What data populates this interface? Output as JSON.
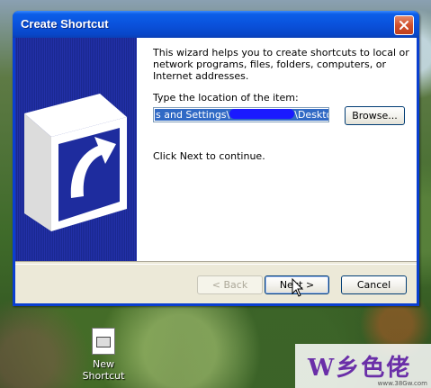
{
  "window": {
    "title": "Create Shortcut"
  },
  "wizard": {
    "intro": "This wizard helps you to create shortcuts to local or network programs, files, folders, computers, or Internet addresses.",
    "type_label": "Type the location of the item:",
    "location_value_start": "s and Settings\\",
    "location_value_end": "\\Desktop\\",
    "continue_text": "Click Next to continue."
  },
  "buttons": {
    "browse": "Browse...",
    "back": "< Back",
    "next": "Next >",
    "cancel": "Cancel"
  },
  "desktop": {
    "icon_label": "New Shortcut"
  },
  "watermark": {
    "text": "W乡色佬",
    "url": "www.38Gw.com"
  },
  "colors": {
    "titlebar": "#0a52dc",
    "side_panel": "#1e2c9e",
    "selection": "#316ac5"
  }
}
